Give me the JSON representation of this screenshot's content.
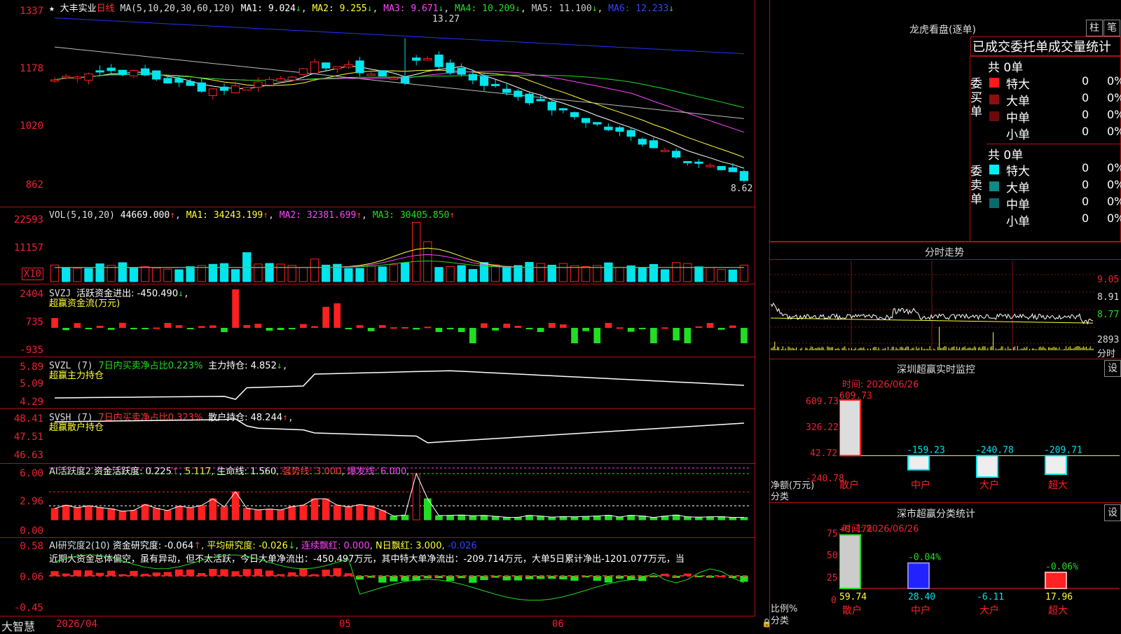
{
  "colors": {
    "up": "#ff2020",
    "down": "#00e5ee",
    "green": "#22dd22",
    "yellow": "#ffff33",
    "magenta": "#ff44ff",
    "white": "#ffffff",
    "grid": "#b01010"
  },
  "kline": {
    "title": "大丰实业",
    "period": "日线",
    "ma_label": "MA(5,10,20,30,60,120)",
    "mas": [
      {
        "label": "MA1: 9.024",
        "arrow": "↓"
      },
      {
        "label": "MA2: 9.255",
        "arrow": "↓"
      },
      {
        "label": "MA3: 9.671",
        "arrow": "↓"
      },
      {
        "label": "MA4: 10.209",
        "arrow": "↓"
      },
      {
        "label": "MA5: 11.100",
        "arrow": "↓"
      },
      {
        "label": "MA6: 12.233",
        "arrow": "↓"
      }
    ],
    "yticks": [
      "1337",
      "1178",
      "1020",
      "862"
    ],
    "high_label": "13.27",
    "low_label": "8.62"
  },
  "vol": {
    "header": "VOL(5,10,20)",
    "value": "44669.000",
    "ma1": "MA1: 34243.199",
    "ma2": "MA2: 32381.699",
    "ma3": "MA3: 30405.850",
    "arrow": "↑",
    "yticks": [
      "22593",
      "11157"
    ],
    "unit": "X10"
  },
  "svzj": {
    "header": "SVZJ",
    "label": "活跃资金进出: -450.490",
    "arrow": "↓",
    "sub": "超赢资金流(万元)",
    "yticks": [
      "2404",
      "735",
      "-935"
    ]
  },
  "svzl": {
    "header": "SVZL (7)",
    "pct": "7日内买卖净占比0.223%",
    "hold": "主力持仓: 4.852",
    "arrow": "↓",
    "sub": "超赢主力持仓",
    "yticks": [
      "5.89",
      "5.09",
      "4.29"
    ]
  },
  "svsh": {
    "header": "SVSH (7)",
    "pct": "7日内买卖净占比0.323%",
    "hold": "散户持仓: 48.244",
    "arrow": "↑",
    "sub": "超赢散户持仓",
    "yticks": [
      "48.41",
      "47.51",
      "46.63"
    ]
  },
  "ai1": {
    "header": "AI活跃度2",
    "active": "资金活跃度: 0.225",
    "v2": "5.117",
    "life": "生命线: 1.560",
    "strong": "强势线: 3.000",
    "boom": "爆发线: 6.000",
    "yticks": [
      "6.00",
      "2.96",
      "0.00"
    ]
  },
  "ai2": {
    "header": "AI研究度2(10)",
    "research": "资金研究度: -0.064",
    "avg": "平均研究度: -0.026",
    "red": "连续飘红: 0.000",
    "n": "N日飘红: 3.000",
    "last": "-0.026",
    "text": "近期大资金总体偏空，虽有异动，但不太活跃，今日大单净流出：-450.497万元，其中特大单净流出：-209.714万元，大单5日累计净出-1201.077万元，当",
    "yticks": [
      "0.58",
      "0.06",
      "-0.45"
    ]
  },
  "xaxis": {
    "brand": "大智慧",
    "labels": [
      "2026/04",
      "05",
      "06"
    ]
  },
  "lhb": {
    "title": "龙虎看盘(逐单)",
    "btn1": "柱",
    "btn2": "笔",
    "tabs": "已成交委托单成交量统计",
    "buy": {
      "label": "委买单",
      "total": "共 0单",
      "rows": [
        {
          "name": "特大",
          "v": "0",
          "p": "0%",
          "color": "#ff1a1a"
        },
        {
          "name": "大单",
          "v": "0",
          "p": "0%",
          "color": "#8a1010"
        },
        {
          "name": "中单",
          "v": "0",
          "p": "0%",
          "color": "#6a0a0a"
        },
        {
          "name": "小单",
          "v": "0",
          "p": "0%",
          "color": ""
        }
      ]
    },
    "sell": {
      "label": "委卖单",
      "total": "共 0单",
      "rows": [
        {
          "name": "特大",
          "v": "0",
          "p": "0%",
          "color": "#00f0f0"
        },
        {
          "name": "大单",
          "v": "0",
          "p": "0%",
          "color": "#0a8a8a"
        },
        {
          "name": "中单",
          "v": "0",
          "p": "0%",
          "color": "#0a6a6a"
        },
        {
          "name": "小单",
          "v": "0",
          "p": "0%",
          "color": ""
        }
      ]
    }
  },
  "intraday": {
    "title": "分时走势",
    "yticks": [
      "9.05",
      "8.91",
      "8.77"
    ],
    "vol": "2893",
    "unit": "分时"
  },
  "sz_monitor": {
    "title": "深圳超赢实时监控",
    "btn": "设",
    "time": "时间: 2026/06/26",
    "yticks": [
      "609.73",
      "326.22",
      "42.72",
      "-240.78"
    ],
    "ylabel": "净额(万元)",
    "xlabel": "分类",
    "cats": [
      "散户",
      "中户",
      "大户",
      "超大"
    ],
    "values": [
      "609.73",
      "-159.23",
      "-240.78",
      "-209.71"
    ]
  },
  "sz_stats": {
    "title": "深市超赢分类统计",
    "btn": "设",
    "time": "时间: 2026/06/26",
    "yticks": [
      "75",
      "50",
      "25",
      "0"
    ],
    "ylabel": "比例%",
    "xlabel": "分类",
    "cats": [
      "散户",
      "中户",
      "大户",
      "超大"
    ],
    "top": [
      "+0.17%",
      "-0.04%",
      "",
      "-0.06%"
    ],
    "bottom": [
      "59.74",
      "28.40",
      "-6.11",
      "17.96"
    ]
  }
}
